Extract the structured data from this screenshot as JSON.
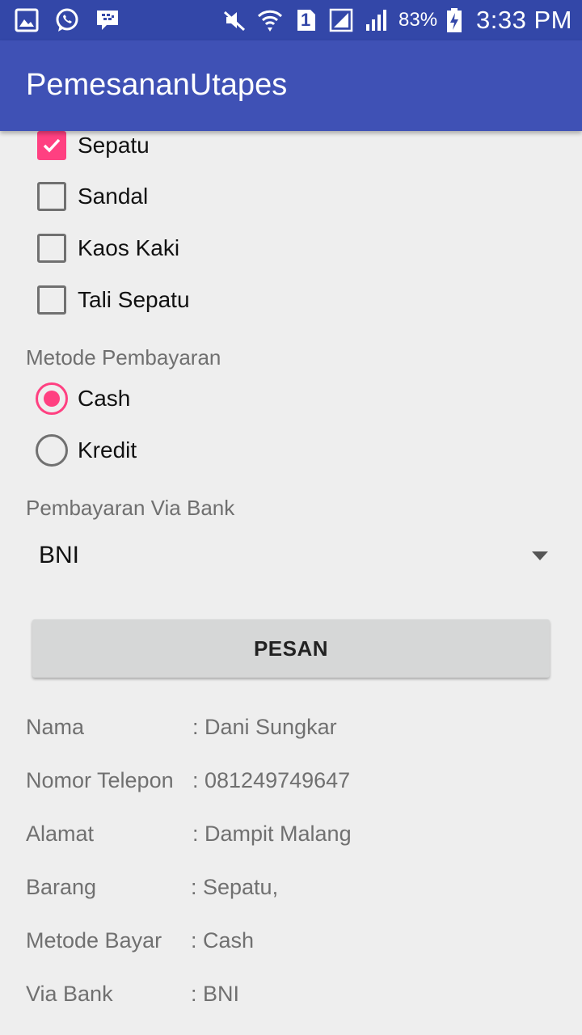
{
  "status_bar": {
    "battery_percent": "83%",
    "time": "3:33 PM",
    "sim_number": "1",
    "left_icons": [
      "gallery-icon",
      "whatsapp-icon",
      "bbm-icon"
    ],
    "right_icons": [
      "mute-icon",
      "wifi-icon",
      "sim-icon",
      "signal-icon",
      "signal-icon",
      "battery-charging-icon"
    ]
  },
  "app_bar": {
    "title": "PemesananUtapes",
    "color": "#3f51b5"
  },
  "items": [
    {
      "label": "Sepatu",
      "checked": true
    },
    {
      "label": "Sandal",
      "checked": false
    },
    {
      "label": "Kaos Kaki",
      "checked": false
    },
    {
      "label": "Tali Sepatu",
      "checked": false
    }
  ],
  "payment": {
    "label": "Metode Pembayaran",
    "options": [
      {
        "label": "Cash",
        "selected": true
      },
      {
        "label": "Kredit",
        "selected": false
      }
    ]
  },
  "bank": {
    "label": "Pembayaran Via Bank",
    "selected": "BNI"
  },
  "order_button": {
    "label": "PESAN"
  },
  "summary": [
    {
      "key": "Nama",
      "value": ": Dani Sungkar"
    },
    {
      "key": "Nomor Telepon",
      "value": ": 081249749647"
    },
    {
      "key": "Alamat",
      "value": ": Dampit Malang"
    },
    {
      "key": "Barang",
      "value": ": Sepatu,"
    },
    {
      "key": "Metode Bayar",
      "value": ": Cash"
    },
    {
      "key": "Via Bank",
      "value": ": BNI"
    }
  ],
  "accent_color": "#ff4081"
}
